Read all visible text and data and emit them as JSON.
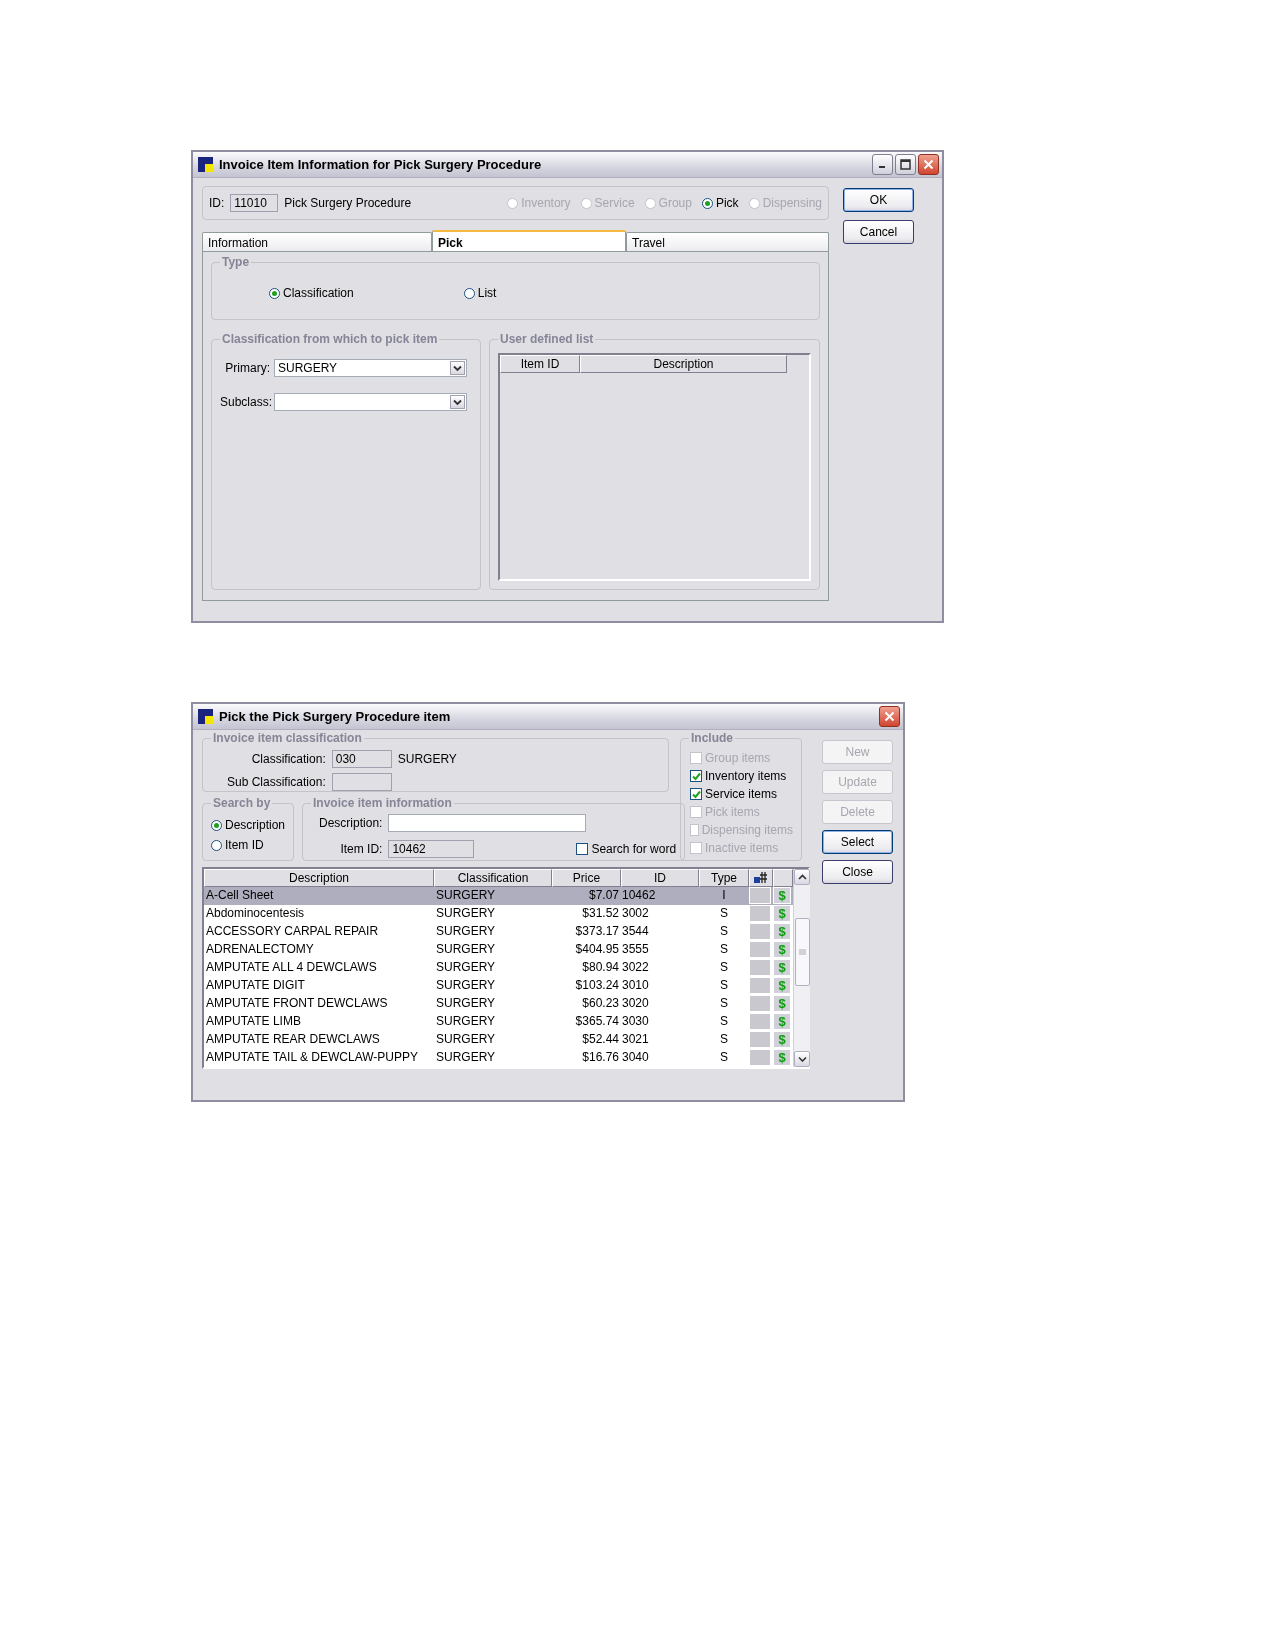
{
  "item_window": {
    "title": "Invoice Item Information for Pick Surgery Procedure",
    "id_label": "ID:",
    "id_value": "11010",
    "name": "Pick Surgery Procedure",
    "item_types": [
      {
        "label": "Inventory",
        "selected": false,
        "disabled": true
      },
      {
        "label": "Service",
        "selected": false,
        "disabled": true
      },
      {
        "label": "Group",
        "selected": false,
        "disabled": true
      },
      {
        "label": "Pick",
        "selected": true,
        "disabled": false
      },
      {
        "label": "Dispensing",
        "selected": false,
        "disabled": true
      }
    ],
    "buttons": [
      {
        "label": "OK",
        "default": true
      },
      {
        "label": "Cancel",
        "default": false
      }
    ],
    "tabs": [
      {
        "label": "Information",
        "selected": false
      },
      {
        "label": "Pick",
        "selected": true
      },
      {
        "label": "Travel",
        "selected": false
      }
    ],
    "type_group": {
      "title": "Type",
      "options": [
        {
          "label": "Classification",
          "selected": true
        },
        {
          "label": "List",
          "selected": false
        }
      ]
    },
    "classification_group": {
      "title": "Classification from which to pick item",
      "fields": [
        {
          "label": "Primary:",
          "value": "SURGERY"
        },
        {
          "label": "Subclass:"
        }
      ]
    },
    "user_list": {
      "title": "User defined list",
      "columns": [
        "Item ID",
        "Description"
      ]
    }
  },
  "pick_window": {
    "title": "Pick the Pick Surgery Procedure item",
    "classification_group": {
      "title": "Invoice item classification",
      "fields": [
        {
          "label": "Classification:",
          "value": "030",
          "text": "SURGERY"
        },
        {
          "label": "Sub Classification:"
        }
      ]
    },
    "search_by": {
      "title": "Search by",
      "options": [
        {
          "label": "Description",
          "selected": true
        },
        {
          "label": "Item ID",
          "selected": false
        }
      ]
    },
    "item_info": {
      "title": "Invoice item information",
      "description_label": "Description:",
      "item_id_label": "Item ID:",
      "item_id_value": "10462",
      "search_for_word": {
        "label": "Search for word",
        "checked": false
      }
    },
    "include": {
      "title": "Include",
      "items": [
        {
          "label": "Group items",
          "checked": false,
          "disabled": true
        },
        {
          "label": "Inventory items",
          "checked": true,
          "disabled": false
        },
        {
          "label": "Service items",
          "checked": true,
          "disabled": false
        },
        {
          "label": "Pick items",
          "checked": false,
          "disabled": true
        },
        {
          "label": "Dispensing items",
          "checked": false,
          "disabled": true
        },
        {
          "label": "Inactive items",
          "checked": false,
          "disabled": true
        }
      ]
    },
    "buttons": [
      {
        "label": "New",
        "disabled": true,
        "default": false
      },
      {
        "label": "Update",
        "disabled": true,
        "default": false
      },
      {
        "label": "Delete",
        "disabled": true,
        "default": false
      },
      {
        "label": "Select",
        "disabled": false,
        "default": true
      },
      {
        "label": "Close",
        "disabled": false,
        "default": false
      }
    ],
    "table": {
      "columns": [
        "Description",
        "Classification",
        "Price",
        "ID",
        "Type"
      ],
      "rows": [
        {
          "description": "A-Cell Sheet",
          "classification": "SURGERY",
          "price": "$7.07",
          "id": "10462",
          "type": "I",
          "marker": "$",
          "selected": true
        },
        {
          "description": "Abdominocentesis",
          "classification": "SURGERY",
          "price": "$31.52",
          "id": "3002",
          "type": "S",
          "marker": "$",
          "selected": false
        },
        {
          "description": "ACCESSORY CARPAL REPAIR",
          "classification": "SURGERY",
          "price": "$373.17",
          "id": "3544",
          "type": "S",
          "marker": "$",
          "selected": false
        },
        {
          "description": "ADRENALECTOMY",
          "classification": "SURGERY",
          "price": "$404.95",
          "id": "3555",
          "type": "S",
          "marker": "$",
          "selected": false
        },
        {
          "description": "AMPUTATE ALL 4 DEWCLAWS",
          "classification": "SURGERY",
          "price": "$80.94",
          "id": "3022",
          "type": "S",
          "marker": "$",
          "selected": false
        },
        {
          "description": "AMPUTATE DIGIT",
          "classification": "SURGERY",
          "price": "$103.24",
          "id": "3010",
          "type": "S",
          "marker": "$",
          "selected": false
        },
        {
          "description": "AMPUTATE FRONT DEWCLAWS",
          "classification": "SURGERY",
          "price": "$60.23",
          "id": "3020",
          "type": "S",
          "marker": "$",
          "selected": false
        },
        {
          "description": "AMPUTATE LIMB",
          "classification": "SURGERY",
          "price": "$365.74",
          "id": "3030",
          "type": "S",
          "marker": "$",
          "selected": false
        },
        {
          "description": "AMPUTATE REAR DEWCLAWS",
          "classification": "SURGERY",
          "price": "$52.44",
          "id": "3021",
          "type": "S",
          "marker": "$",
          "selected": false
        },
        {
          "description": "AMPUTATE TAIL & DEWCLAW-PUPPY",
          "classification": "SURGERY",
          "price": "$16.76",
          "id": "3040",
          "type": "S",
          "marker": "$",
          "selected": false
        }
      ]
    }
  }
}
